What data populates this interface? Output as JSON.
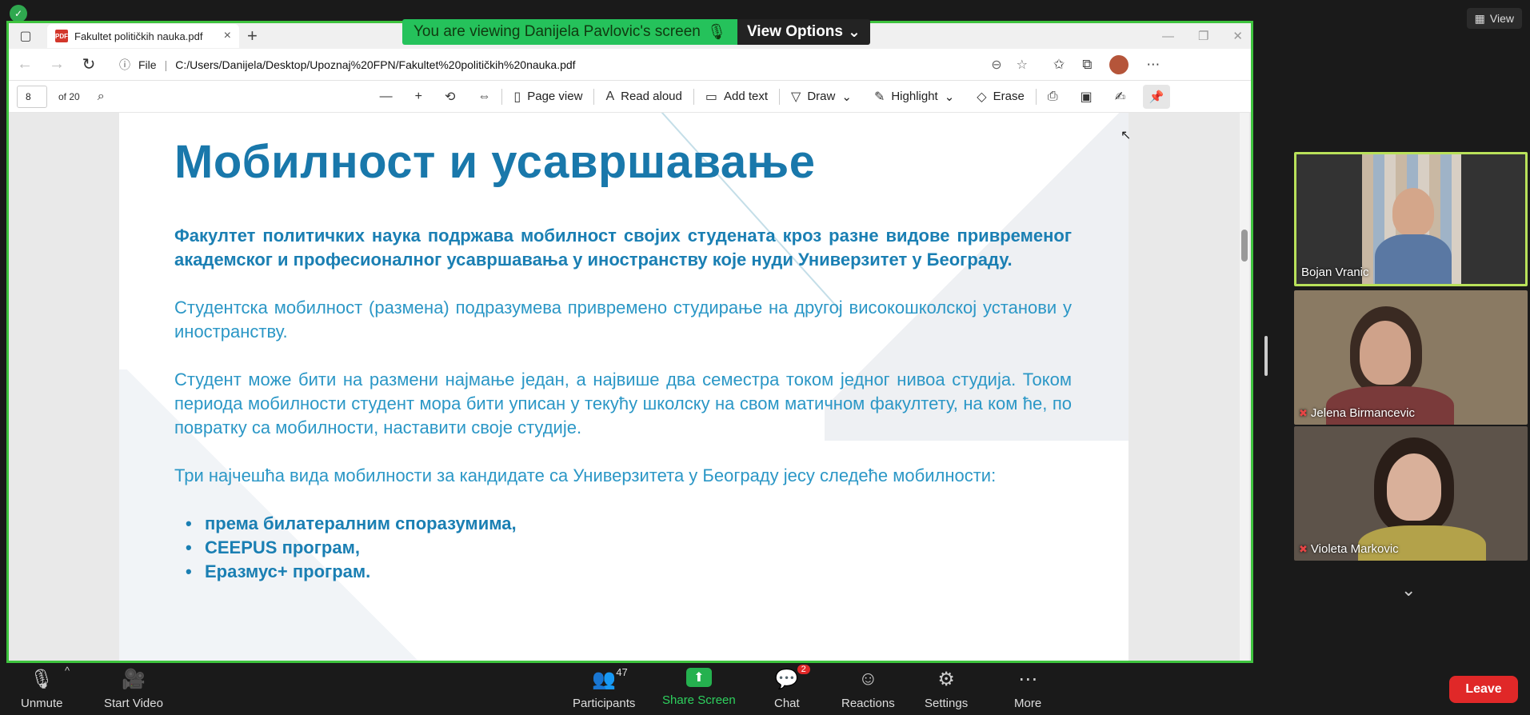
{
  "zoom": {
    "view_label": "View",
    "banner_text": "You are viewing Danijela Pavlovic's screen",
    "view_options_label": "View Options",
    "participants": [
      {
        "name": "Bojan Vranic",
        "active": true,
        "muted": false
      },
      {
        "name": "Jelena Birmancevic",
        "active": false,
        "muted": true
      },
      {
        "name": "Violeta Markovic",
        "active": false,
        "muted": true
      }
    ],
    "toolbar": {
      "unmute": "Unmute",
      "start_video": "Start Video",
      "participants": "Participants",
      "participants_count": "47",
      "share_screen": "Share Screen",
      "chat": "Chat",
      "chat_badge": "2",
      "reactions": "Reactions",
      "settings": "Settings",
      "more": "More",
      "leave": "Leave"
    }
  },
  "browser": {
    "tab_title": "Fakultet političkih nauka.pdf",
    "pdf_badge": "PDF",
    "url_prefix": "File",
    "url": "C:/Users/Danijela/Desktop/Upoznaj%20FPN/Fakultet%20političkih%20nauka.pdf"
  },
  "pdf_toolbar": {
    "page_number": "8",
    "page_total": "of 20",
    "page_view": "Page view",
    "read_aloud": "Read aloud",
    "add_text": "Add text",
    "draw": "Draw",
    "highlight": "Highlight",
    "erase": "Erase"
  },
  "document": {
    "title": "Мобилност и усавршавање",
    "lead": "Факултет политичких наука подржава мобилност својих студената кроз разне видове привременог академског и професионалног усавршавања у иностранству које нуди Универзитет у Београду.",
    "p1": "Студентска мобилност (размена) подразумева привремено студирање на другој високошколској установи у иностранству.",
    "p2": "Студент може бити на размени најмање један, а највише два семестра током једног нивоа студија. Током периода мобилности студент мора бити уписан у текућу школску на свом матичном факултету, на ком ће, по повратку са мобилности, наставити своје студије.",
    "p3": "Три најчешћа вида мобилности за кандидате са Универзитета у Београду јесу следеће мобилности:",
    "list": [
      "према билатералним споразумима,",
      "CEEPUS програм,",
      "Еразмус+ програм."
    ]
  }
}
